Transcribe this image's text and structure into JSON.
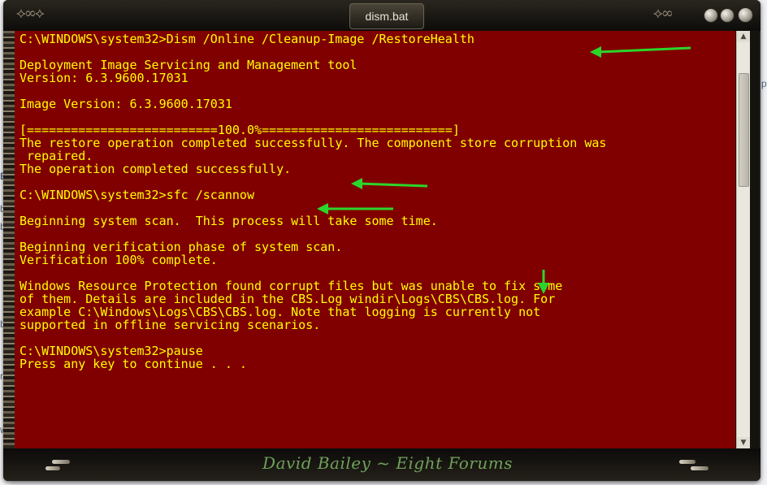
{
  "window": {
    "title": "dism.bat",
    "signature": "David Bailey ~ Eight Forums"
  },
  "console": {
    "lines": [
      "C:\\WINDOWS\\system32>Dism /Online /Cleanup-Image /RestoreHealth",
      "",
      "Deployment Image Servicing and Management tool",
      "Version: 6.3.9600.17031",
      "",
      "Image Version: 6.3.9600.17031",
      "",
      "[==========================100.0%==========================]",
      "The restore operation completed successfully. The component store corruption was",
      " repaired.",
      "The operation completed successfully.",
      "",
      "C:\\WINDOWS\\system32>sfc /scannow",
      "",
      "Beginning system scan.  This process will take some time.",
      "",
      "Beginning verification phase of system scan.",
      "Verification 100% complete.",
      "",
      "Windows Resource Protection found corrupt files but was unable to fix some",
      "of them. Details are included in the CBS.Log windir\\Logs\\CBS\\CBS.log. For",
      "example C:\\Windows\\Logs\\CBS\\CBS.log. Note that logging is currently not",
      "supported in offline servicing scenarios.",
      "",
      "C:\\WINDOWS\\system32>pause",
      "Press any key to continue . . ."
    ]
  },
  "background_page": {
    "left_fragments": [
      "b",
      "b",
      "B",
      "b",
      "n",
      "w"
    ],
    "right_fragments": [
      "p"
    ]
  },
  "colors": {
    "console_bg": "#800000",
    "console_text": "#ffff00",
    "annotation_arrow": "#2bd62b",
    "signature": "#6fa05a"
  }
}
